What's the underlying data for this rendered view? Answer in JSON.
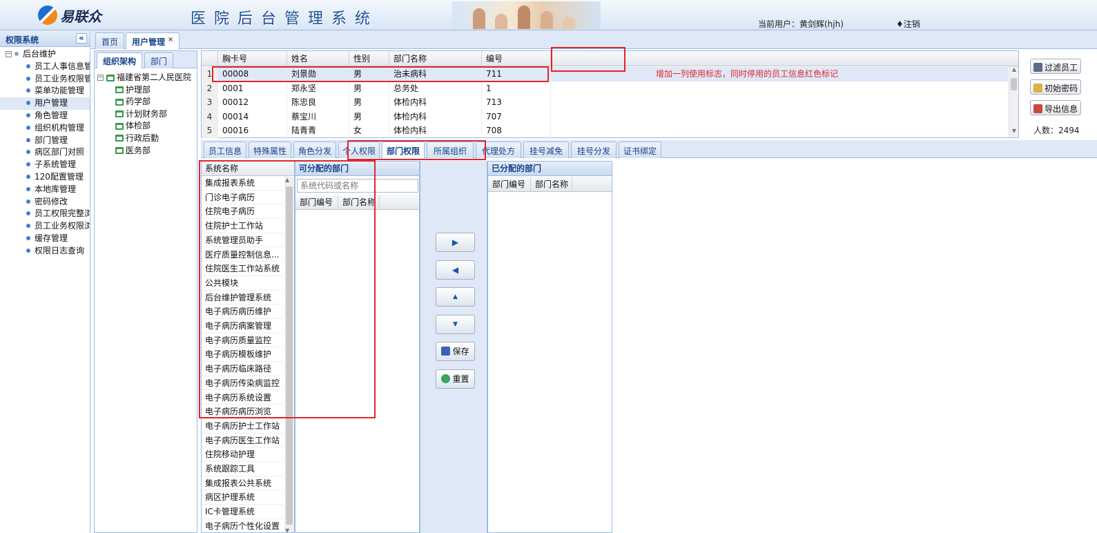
{
  "header": {
    "brand": "易联众",
    "system_title": "医院后台管理系统",
    "current_user": "当前用户：黄剑辉(hjh)",
    "logout": "♦注销"
  },
  "sidebar": {
    "title": "权限系统",
    "collapse": "«",
    "root": "后台维护",
    "items": [
      "员工人事信息管理",
      "员工业务权限管理",
      "菜单功能管理",
      "用户管理",
      "角色管理",
      "组织机构管理",
      "部门管理",
      "病区部门对照",
      "子系统管理",
      "120配置管理",
      "本地库管理",
      "密码修改",
      "员工权限完整浏览",
      "员工业务权限浏览",
      "缓存管理",
      "权限日志查询"
    ],
    "selected_index": 3
  },
  "main_tabs": [
    {
      "label": "首页"
    },
    {
      "label": "用户管理",
      "close": "×"
    }
  ],
  "org": {
    "tabs": [
      "组织架构",
      "部门"
    ],
    "root": "福建省第二人民医院",
    "children": [
      "护理部",
      "药学部",
      "计划财务部",
      "体检部",
      "行政后勤",
      "医务部"
    ]
  },
  "grid": {
    "columns": [
      "胸卡号",
      "姓名",
      "性别",
      "部门名称",
      "编号"
    ],
    "rows": [
      {
        "n": "1",
        "card": "00008",
        "name": "刘景勋",
        "gender": "男",
        "dept": "治未病科",
        "code": "711"
      },
      {
        "n": "2",
        "card": "0001",
        "name": "郑永坚",
        "gender": "男",
        "dept": "总务处",
        "code": "1"
      },
      {
        "n": "3",
        "card": "00012",
        "name": "陈忠良",
        "gender": "男",
        "dept": "体检内科",
        "code": "713"
      },
      {
        "n": "4",
        "card": "00014",
        "name": "蔡宝川",
        "gender": "男",
        "dept": "体检内科",
        "code": "707"
      },
      {
        "n": "5",
        "card": "00016",
        "name": "陆青青",
        "gender": "女",
        "dept": "体检内科",
        "code": "708"
      }
    ]
  },
  "annotation": "增加一列使用标志，同时停用的员工信息红色标记",
  "actions": {
    "filter": "过滤员工",
    "init_pwd": "初始密码",
    "export": "导出信息",
    "count": "人数：2494"
  },
  "sub_tabs": [
    "员工信息",
    "特殊属性",
    "角色分发",
    "个人权限",
    "部门权限",
    "所属组织",
    "代理处方",
    "挂号减免",
    "挂号分发",
    "证书绑定"
  ],
  "active_sub_tab": "部门权限",
  "systems": {
    "header": "系统名称",
    "items": [
      "集成报表系统",
      "门诊电子病历",
      "住院电子病历",
      "住院护士工作站",
      "系统管理员助手",
      "医疗质量控制信息...",
      "住院医生工作站系统",
      "公共模块",
      "后台维护管理系统",
      "电子病历病历维护",
      "电子病历病案管理",
      "电子病历质量监控",
      "电子病历模板维护",
      "电子病历临床路径",
      "电子病历传染病监控",
      "电子病历系统设置",
      "电子病历病历浏览",
      "电子病历护士工作站",
      "电子病历医生工作站",
      "住院移动护理",
      "系统跟踪工具",
      "集成报表公共系统",
      "病区护理系统",
      "IC卡管理系统",
      "电子病历个性化设置"
    ]
  },
  "available": {
    "title": "可分配的部门",
    "search_placeholder": "系统代码或名称",
    "col_code": "部门编号",
    "col_name": "部门名称"
  },
  "assigned": {
    "title": "已分配的部门",
    "col_code": "部门编号",
    "col_name": "部门名称"
  },
  "buttons": {
    "right": "▶",
    "left": "◀",
    "up": "▲",
    "down": "▼",
    "save": "保存",
    "reset": "重置"
  },
  "colors": {
    "accent": "#15428b",
    "selection": "#dfe8f6",
    "annotation": "#e0262b"
  }
}
